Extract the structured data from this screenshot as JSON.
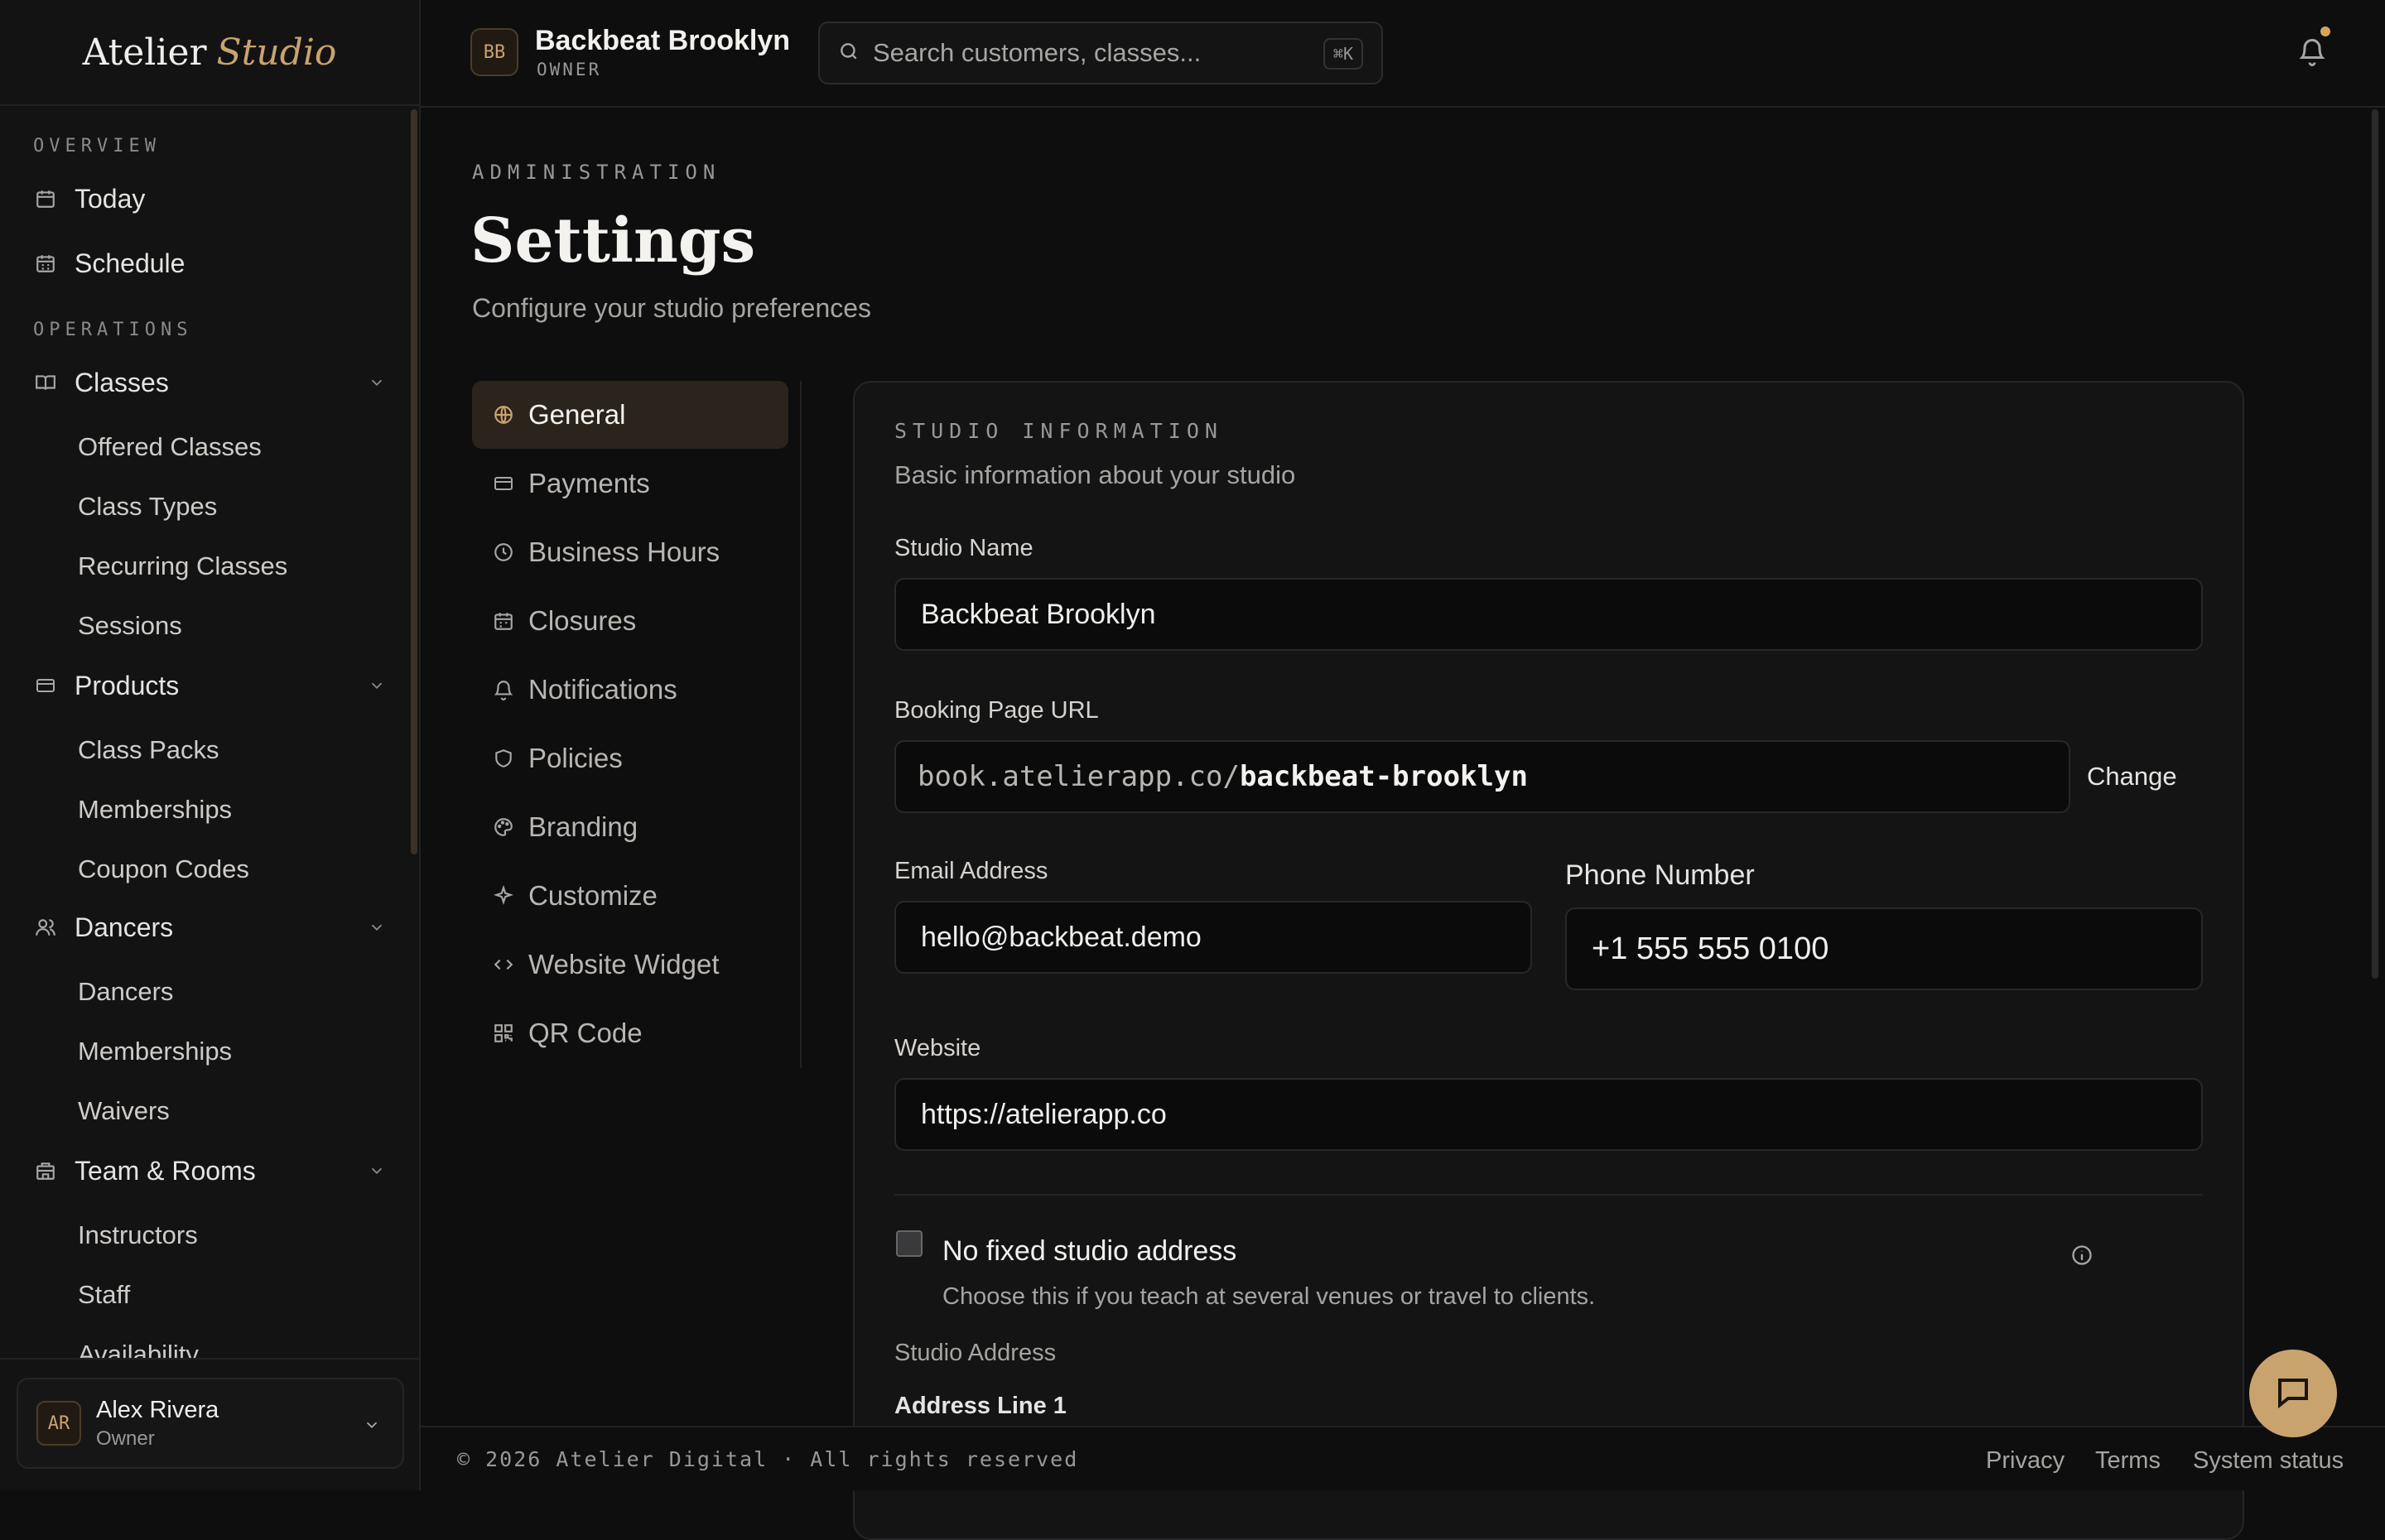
{
  "brand": {
    "name": "Atelier",
    "accent": "Studio"
  },
  "colors": {
    "accent": "#c9a36e",
    "background": "#0e0e0f",
    "panel": "#141415",
    "active_nav": "#2a241d"
  },
  "sidebar": {
    "sections": [
      {
        "label": "OVERVIEW"
      },
      {
        "label": "OPERATIONS"
      }
    ],
    "top_items": [
      {
        "label": "Today",
        "icon": "calendar-icon"
      },
      {
        "label": "Schedule",
        "icon": "calendar-grid-icon"
      }
    ],
    "groups": [
      {
        "label": "Classes",
        "icon": "book-icon",
        "children": [
          "Offered Classes",
          "Class Types",
          "Recurring Classes",
          "Sessions"
        ]
      },
      {
        "label": "Products",
        "icon": "card-icon",
        "children": [
          "Class Packs",
          "Memberships",
          "Coupon Codes"
        ]
      },
      {
        "label": "Dancers",
        "icon": "users-icon",
        "children": [
          "Dancers",
          "Memberships",
          "Waivers"
        ]
      },
      {
        "label": "Team & Rooms",
        "icon": "building-icon",
        "children": [
          "Instructors",
          "Staff",
          "Availability"
        ]
      }
    ]
  },
  "user": {
    "initials": "AR",
    "name": "Alex Rivera",
    "role": "Owner"
  },
  "header": {
    "studio_initials": "BB",
    "studio_name": "Backbeat Brooklyn",
    "studio_role": "OWNER",
    "search_placeholder": "Search customers, classes...",
    "search_shortcut": "⌘K"
  },
  "page": {
    "eyebrow": "ADMINISTRATION",
    "title": "Settings",
    "subtitle": "Configure your studio preferences"
  },
  "settings_nav": [
    {
      "label": "General",
      "icon": "globe-icon",
      "active": true
    },
    {
      "label": "Payments",
      "icon": "card-icon"
    },
    {
      "label": "Business Hours",
      "icon": "clock-icon"
    },
    {
      "label": "Closures",
      "icon": "calendar-icon"
    },
    {
      "label": "Notifications",
      "icon": "bell-icon"
    },
    {
      "label": "Policies",
      "icon": "shield-icon"
    },
    {
      "label": "Branding",
      "icon": "palette-icon"
    },
    {
      "label": "Customize",
      "icon": "sparkle-icon"
    },
    {
      "label": "Website Widget",
      "icon": "code-icon"
    },
    {
      "label": "QR Code",
      "icon": "qr-icon"
    }
  ],
  "card": {
    "eyebrow": "STUDIO INFORMATION",
    "subtitle": "Basic information about your studio",
    "studio_name_label": "Studio Name",
    "studio_name_value": "Backbeat Brooklyn",
    "booking_url_label": "Booking Page URL",
    "booking_url_prefix": "book.atelierapp.co/",
    "booking_url_slug": "backbeat-brooklyn",
    "change_label": "Change",
    "email_label": "Email Address",
    "email_value": "hello@backbeat.demo",
    "phone_label": "Phone Number",
    "phone_value": "+1 555 555 0100",
    "website_label": "Website",
    "website_value": "https://atelierapp.co",
    "no_address_label": "No fixed studio address",
    "no_address_checked": false,
    "no_address_help": "Choose this if you teach at several venues or travel to clients.",
    "address_title": "Studio Address",
    "address_line1_label": "Address Line 1"
  },
  "footer": {
    "copyright": "© 2026 Atelier Digital · All rights reserved",
    "links": [
      "Privacy",
      "Terms",
      "System status"
    ]
  }
}
